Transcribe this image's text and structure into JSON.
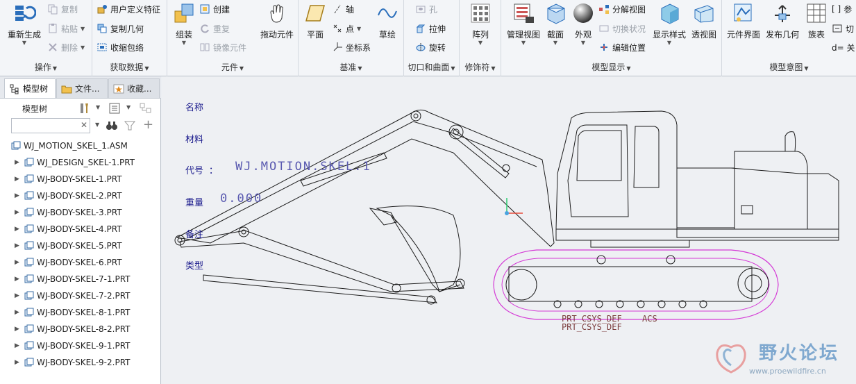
{
  "ribbon": {
    "colors": {
      "accent": "#2a6ebb",
      "disabled": "#9aa0a8"
    },
    "groups": {
      "ops": {
        "label": "操作",
        "regenerate": "重新生成",
        "copy": "复制",
        "paste": "粘贴",
        "delete": "删除"
      },
      "getdata": {
        "label": "获取数据",
        "udf": "用户定义特征",
        "copy_geom": "复制几何",
        "shrinkwrap": "收缩包络"
      },
      "component": {
        "label": "元件",
        "assemble": "组装",
        "create": "创建",
        "repeat": "重复",
        "mirror": "镜像元件",
        "drag": "拖动元件"
      },
      "datum": {
        "label": "基准",
        "plane": "平面",
        "axis": "轴",
        "point": "点",
        "csys": "坐标系",
        "sketch": "草绘"
      },
      "cut": {
        "label": "切口和曲面",
        "hole": "孔",
        "extrude": "拉伸",
        "revolve": "旋转"
      },
      "modifiers": {
        "label": "修饰符",
        "pattern": "阵列"
      },
      "display": {
        "label": "模型显示",
        "manage_views": "管理视图",
        "section": "截面",
        "appearance": "外观",
        "explode": "分解视图",
        "toggle_state": "切换状况",
        "edit_position": "编辑位置",
        "display_style": "显示样式",
        "perspective": "透视图"
      },
      "intent": {
        "label": "模型意图",
        "interface": "元件界面",
        "publish": "发布几何",
        "family": "族表",
        "param": "参",
        "switch": "切",
        "relation": "d= 关"
      }
    }
  },
  "panel": {
    "tabs": [
      "模型树",
      "文件...",
      "收藏..."
    ],
    "tree_title": "模型树",
    "search": {
      "value": "",
      "placeholder": ""
    },
    "items": [
      "WJ_MOTION_SKEL_1.ASM",
      "WJ_DESIGN_SKEL-1.PRT",
      "WJ-BODY-SKEL-1.PRT",
      "WJ-BODY-SKEL-2.PRT",
      "WJ-BODY-SKEL-3.PRT",
      "WJ-BODY-SKEL-4.PRT",
      "WJ-BODY-SKEL-5.PRT",
      "WJ-BODY-SKEL-6.PRT",
      "WJ-BODY-SKEL-7-1.PRT",
      "WJ-BODY-SKEL-7-2.PRT",
      "WJ-BODY-SKEL-8-1.PRT",
      "WJ-BODY-SKEL-8-2.PRT",
      "WJ-BODY-SKEL-9-1.PRT",
      "WJ-BODY-SKEL-9-2.PRT"
    ]
  },
  "canvas": {
    "labels": {
      "name": "名称",
      "material": "材料",
      "code": "代号 ：",
      "code_value": "WJ.MOTION.SKEL.1",
      "weight": "重量",
      "weight_value": "0.000",
      "remark": "备注",
      "type": "类型",
      "prt_csys": "PRT_CSYS_DEF",
      "prt_csys2": "PRT_CSYS_DEF",
      "acs": "ACS"
    },
    "watermark": {
      "title": "野火论坛",
      "url": "www.proewildfire.cn"
    },
    "colors": {
      "line": "#1c1c1c",
      "track": "#d43ad6",
      "annotation": "#1a1a8c"
    }
  }
}
